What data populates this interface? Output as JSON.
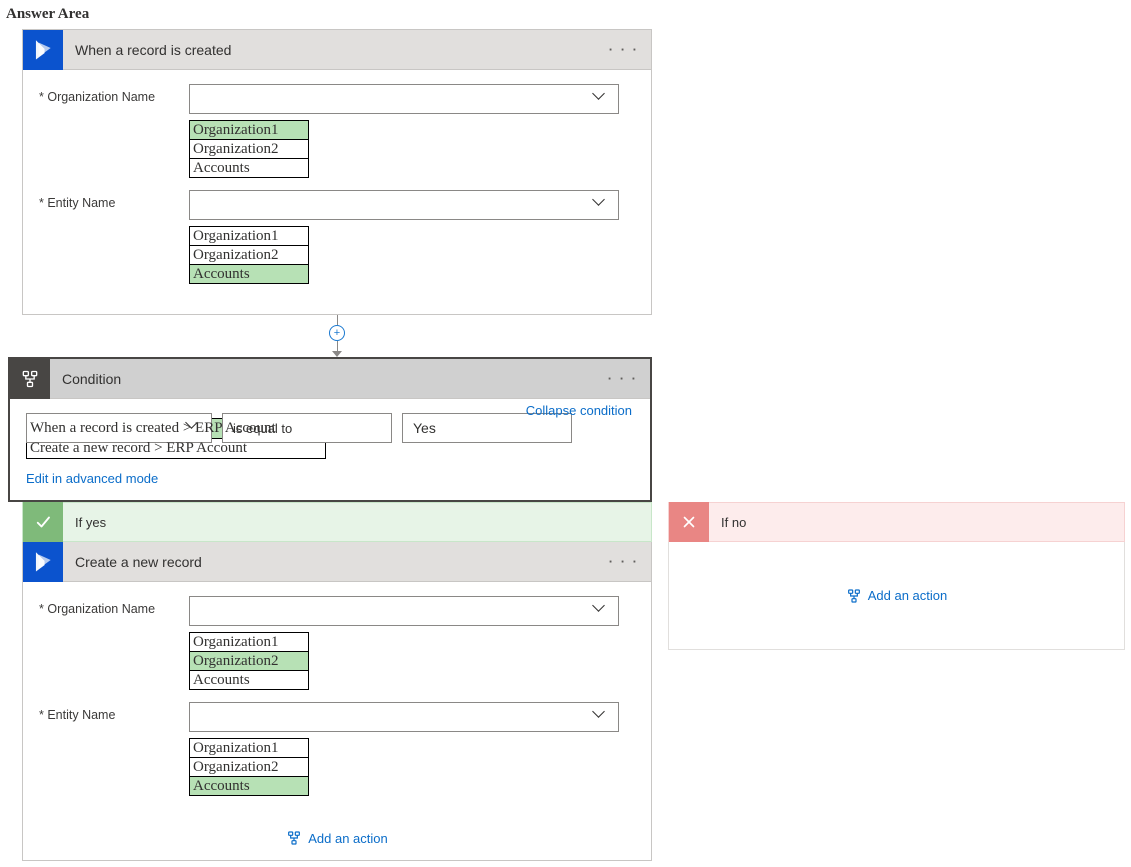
{
  "pageTitle": "Answer Area",
  "trigger": {
    "title": "When a record is created",
    "fields": {
      "orgLabel": "Organization Name",
      "entityLabel": "Entity Name"
    },
    "orgOptions": [
      "Organization1",
      "Organization2",
      "Accounts"
    ],
    "orgSelectedIndex": 0,
    "entityOptions": [
      "Organization1",
      "Organization2",
      "Accounts"
    ],
    "entitySelectedIndex": 2
  },
  "condition": {
    "title": "Condition",
    "operator": "is equal to",
    "rightValue": "Yes",
    "leftOptions": [
      "When a record is created > ERP Account",
      "Create a new record > ERP Account"
    ],
    "leftSelectedIndex": 0,
    "collapseLabel": "Collapse condition",
    "advancedLabel": "Edit in advanced mode"
  },
  "branches": {
    "yesLabel": "If yes",
    "noLabel": "If no",
    "addActionLabel": "Add an action"
  },
  "createRecord": {
    "title": "Create a new record",
    "fields": {
      "orgLabel": "Organization Name",
      "entityLabel": "Entity Name"
    },
    "orgOptions": [
      "Organization1",
      "Organization2",
      "Accounts"
    ],
    "orgSelectedIndex": 1,
    "entityOptions": [
      "Organization1",
      "Organization2",
      "Accounts"
    ],
    "entitySelectedIndex": 2
  }
}
